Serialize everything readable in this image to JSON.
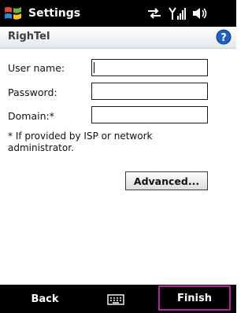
{
  "title_bar": {
    "title": "Settings",
    "status_icons": [
      "data-sync-icon",
      "signal-strength-icon",
      "speaker-icon"
    ]
  },
  "header": {
    "title": "RighTel",
    "help_icon": "help-icon"
  },
  "form": {
    "username_label": "User name:",
    "username_value": "",
    "password_label": "Password:",
    "password_value": "",
    "domain_label": "Domain:*",
    "domain_value": "",
    "note": "* If provided by ISP or network administrator.",
    "advanced_label": "Advanced..."
  },
  "softkeys": {
    "left_label": "Back",
    "center_icon": "keyboard-icon",
    "right_label": "Finish"
  },
  "colors": {
    "bar_background": "#000000",
    "highlight_border": "#b3249b",
    "help_blue": "#1f5fbf"
  }
}
